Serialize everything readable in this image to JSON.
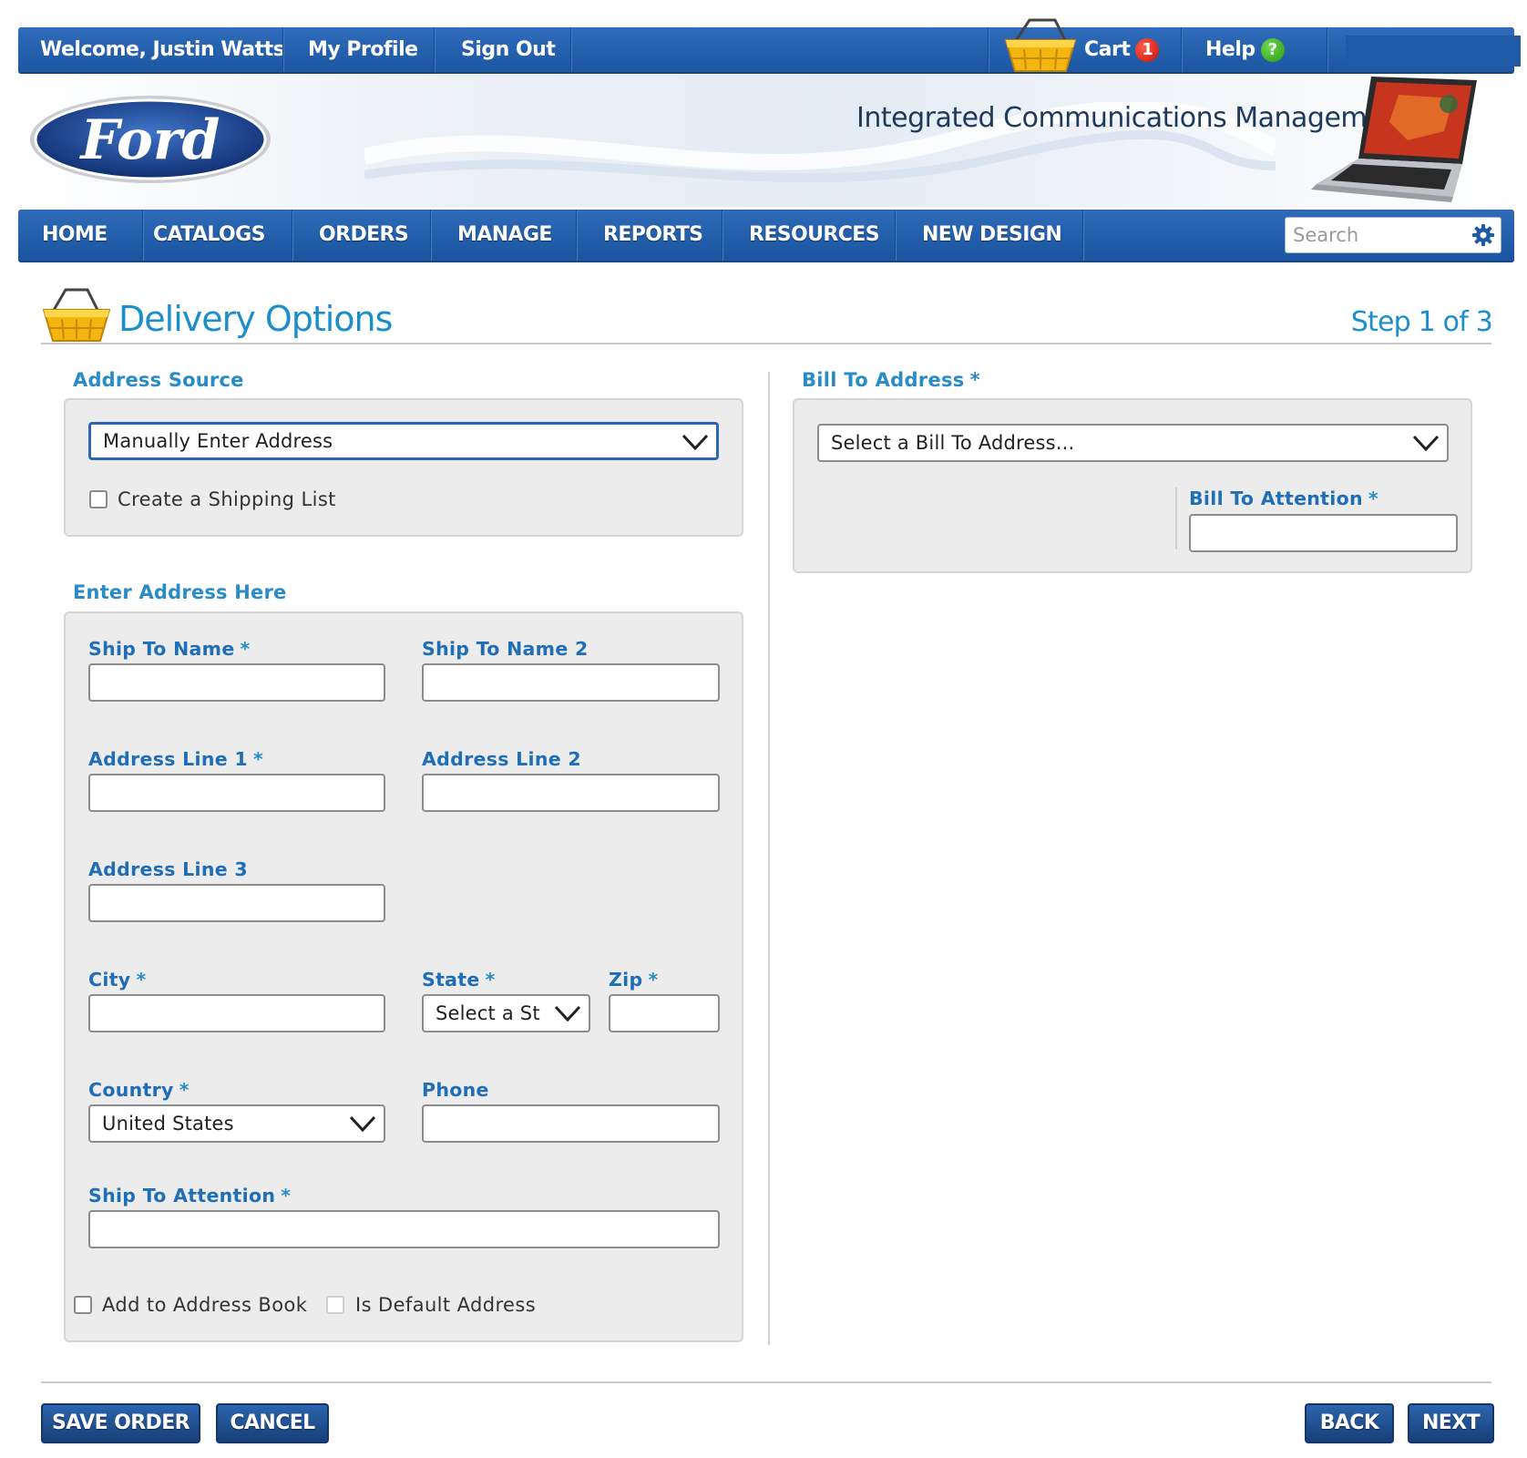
{
  "topbar": {
    "welcome": "Welcome, Justin Watts",
    "my_profile": "My Profile",
    "sign_out": "Sign Out",
    "cart_label": "Cart",
    "cart_count": "1",
    "help_label": "Help",
    "help_icon": "?"
  },
  "banner": {
    "logo_text": "Ford",
    "title": "Integrated Communications Management"
  },
  "nav": {
    "items": [
      "HOME",
      "CATALOGS",
      "ORDERS",
      "MANAGE",
      "REPORTS",
      "RESOURCES",
      "NEW DESIGN"
    ],
    "search_placeholder": "Search"
  },
  "page": {
    "title": "Delivery Options",
    "step": "Step 1 of 3"
  },
  "address_source": {
    "label": "Address Source",
    "selected": "Manually Enter Address",
    "create_list_label": "Create a Shipping List"
  },
  "enter_address": {
    "label": "Enter Address Here",
    "ship_to_name": "Ship To Name",
    "ship_to_name_2": "Ship To Name 2",
    "address_line_1": "Address Line 1",
    "address_line_2": "Address Line 2",
    "address_line_3": "Address Line 3",
    "city": "City",
    "state": "State",
    "state_selected": "Select a St",
    "zip": "Zip",
    "country": "Country",
    "country_selected": "United States",
    "phone": "Phone",
    "ship_to_attention": "Ship To Attention",
    "add_to_book": "Add to Address Book",
    "is_default": "Is Default Address",
    "required_mark": "*"
  },
  "bill_to": {
    "label": "Bill To Address",
    "selected": "Select a Bill To Address...",
    "attention_label": "Bill To Attention"
  },
  "footer": {
    "save_order": "SAVE ORDER",
    "cancel": "CANCEL",
    "back": "BACK",
    "next": "NEXT"
  },
  "colors": {
    "nav_blue": "#1f5ba8",
    "accent_blue": "#1c8ecb",
    "label_blue": "#1f6eb6",
    "panel_gray": "#ececec",
    "cart_badge": "#d0140c",
    "help_badge": "#2fa016"
  }
}
